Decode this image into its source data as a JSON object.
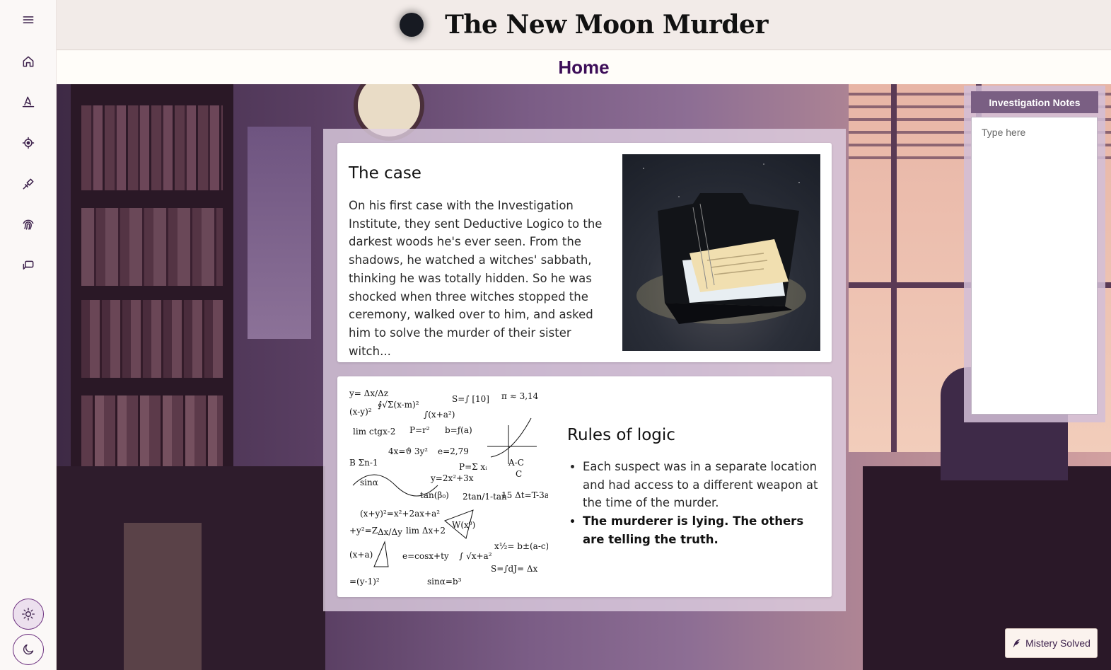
{
  "header": {
    "title": "The New Moon Murder"
  },
  "subheader": {
    "title": "Home"
  },
  "sidebar": {
    "items": [
      {
        "icon": "menu-icon"
      },
      {
        "icon": "home-icon"
      },
      {
        "icon": "witch-hat-icon"
      },
      {
        "icon": "location-target-icon"
      },
      {
        "icon": "weapon-icon"
      },
      {
        "icon": "fingerprint-icon"
      },
      {
        "icon": "chat-icon"
      }
    ],
    "theme": {
      "light": "sun-icon",
      "dark": "moon-icon"
    }
  },
  "case": {
    "title": "The case",
    "text": "On his first case with the Investigation Institute, they sent Deductive Logico to the darkest woods he's ever seen. From the shadows, he watched a witches' sabbath, thinking he was totally hidden. So he was shocked when three witches stopped the ceremony, walked over to him, and asked him to solve the murder of their sister witch..."
  },
  "rules": {
    "title": "Rules of logic",
    "items": [
      "Each suspect was in a separate location and had access to a different weapon at the time of the murder.",
      "The murderer is lying. The others are telling the truth."
    ]
  },
  "notes": {
    "title": "Investigation Notes",
    "placeholder": "Type here"
  },
  "actions": {
    "solved_label": "Mistery Solved"
  }
}
